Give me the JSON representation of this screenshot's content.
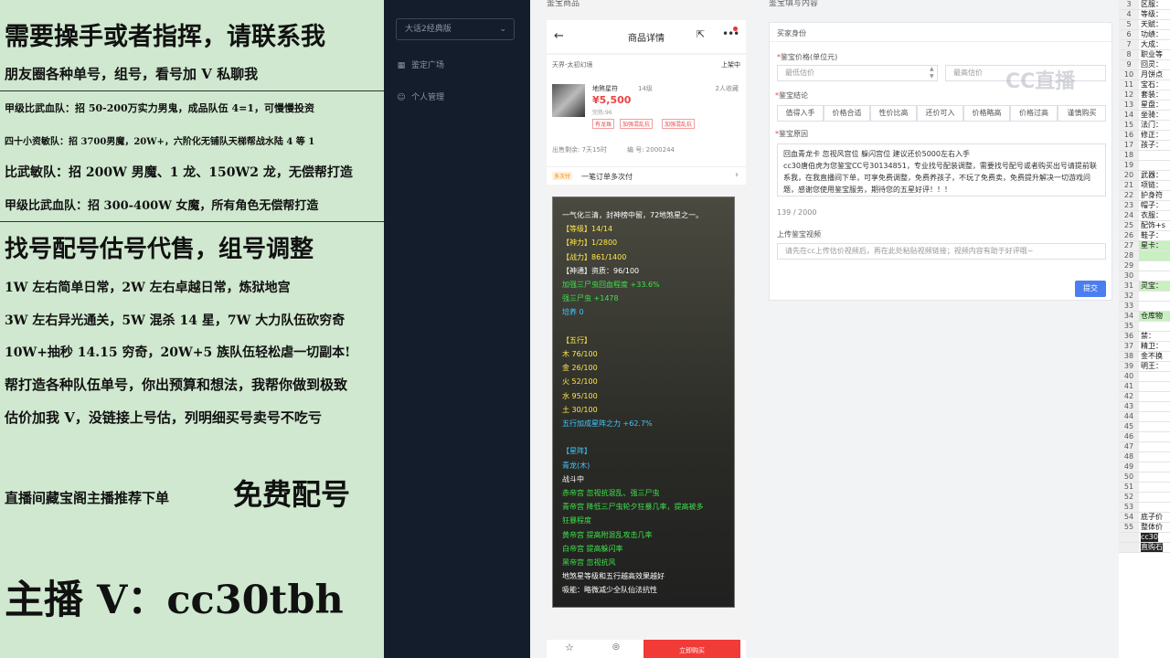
{
  "promo": {
    "lines": [
      "需要操手或者指挥，请联系我",
      "朋友圈各种单号，组号，看号加 V 私聊我",
      "甲级比武血队：招 50-200万实力男鬼，成品队伍 4=1，可慢慢投资",
      "四十小资敏队：招 3700男魔，20W+，六阶化无铺队天梯帮战水陆 4 等 1",
      "比武敏队：招 200W 男魔、1 龙、150W2 龙，无偿帮打造",
      "甲级比武血队：招 300-400W 女魔，所有角色无偿帮打造",
      "找号配号估号代售，组号调整",
      "1W 左右简单日常，2W 左右卓越日常，炼狱地宫",
      "3W 左右异光通关，5W 混杀 14 星，7W 大力队伍砍穷奇",
      "10W+抽秒 14.15 穷奇，20W+5 族队伍轻松虐一切副本!",
      "帮打造各种队伍单号，你出预算和想法，我帮你做到极致",
      "估价加我 V，没链接上号估，列明细买号卖号不吃亏",
      "直播间藏宝阁主播推荐下单",
      "免费配号",
      "主播 V：cc30tbh"
    ]
  },
  "sidebar": {
    "system_select": "大话2经典版",
    "items": [
      "鉴定广场",
      "个人管理"
    ]
  },
  "phone": {
    "column_title": "鉴宝商品",
    "title": "商品详情",
    "server": "天界-太初幻境",
    "status": "上架中",
    "role_name": "地煞星符",
    "level": "14级",
    "favorites": "2人收藏",
    "price": "¥5,500",
    "hint": "完热:96",
    "tags": [
      "有龙珠",
      "加强混乱抗",
      "加强混乱抗"
    ],
    "remaining": "出售剩余: 7天15时",
    "item_id": "编 号: 2000244",
    "promo_tag": "多次付",
    "promo_text": "一笔订单多次付",
    "buy_label": "立即购买",
    "consult_label": "咨询",
    "detail_lines": [
      {
        "t": "一气化三清，封神榜中留，72地煞星之一。",
        "c": "#ffffff"
      },
      {
        "t": "【等级】14/14",
        "c": "#ffe84a"
      },
      {
        "t": "【神力】1/2800",
        "c": "#ffe84a"
      },
      {
        "t": "【战力】861/1400",
        "c": "#ffe84a"
      },
      {
        "t": "【神通】资质：96/100",
        "c": "#ffffff"
      },
      {
        "t": "加强三尸虫回血程度 +33.6%",
        "c": "#3de24a"
      },
      {
        "t": "强三尸虫 +1478",
        "c": "#3de24a"
      },
      {
        "t": "培养 0",
        "c": "#41c7ff"
      },
      {
        "t": "",
        "c": "#ffffff"
      },
      {
        "t": "【五行】",
        "c": "#ffe84a"
      },
      {
        "t": "木 76/100",
        "c": "#ffe84a"
      },
      {
        "t": "金 26/100",
        "c": "#ffe84a"
      },
      {
        "t": "火 52/100",
        "c": "#ffe84a"
      },
      {
        "t": "水 95/100",
        "c": "#ffe84a"
      },
      {
        "t": "土 30/100",
        "c": "#ffe84a"
      },
      {
        "t": "五行加成星阵之力 +62.7%",
        "c": "#41c7ff"
      },
      {
        "t": "",
        "c": "#ffffff"
      },
      {
        "t": "【星阵】",
        "c": "#41c7ff"
      },
      {
        "t": "青龙(木)",
        "c": "#41c7ff"
      },
      {
        "t": "战斗中",
        "c": "#ffffff"
      },
      {
        "t": "赤帝宫 忽视抗混乱、强三尸虫",
        "c": "#3de24a"
      },
      {
        "t": "青帝宫 降低三尸虫轮夕狂暴几率，提高被多",
        "c": "#3de24a"
      },
      {
        "t": "狂暴程度",
        "c": "#3de24a"
      },
      {
        "t": "黄帝宫 提高附混乱攻击几率",
        "c": "#3de24a"
      },
      {
        "t": "白帝宫 提高躲闪率",
        "c": "#3de24a"
      },
      {
        "t": "黑帝宫 忽视抗风",
        "c": "#3de24a"
      },
      {
        "t": "地煞星等级和五行越高效果越好",
        "c": "#ffffff"
      },
      {
        "t": "吸能：略微减少全队仙法抗性",
        "c": "#ffffff"
      }
    ]
  },
  "form": {
    "column_title": "鉴宝填写内容",
    "section": "买家身份",
    "price_label": "鉴宝价格(单位元)",
    "min_placeholder": "最低估价",
    "max_placeholder": "最高估价",
    "conclusion_label": "鉴宝结论",
    "options": [
      "值得入手",
      "价格合适",
      "性价比高",
      "还价可入",
      "价格略高",
      "价格过高",
      "谨慎购买"
    ],
    "reason_label": "鉴宝原因",
    "reason_text": "回血青龙卡 忽视风宫位 躲闪宫位 建议还价5000左右入手\ncc30唐伯虎为您鉴宝CC号30134851，专业找号配装调整，需要找号配号或者购买出号请提前联系我，在我直播间下单，可享免费调整，免费养孩子，不玩了免费卖，免费提升解决一切游戏问题，感谢您使用鉴宝服务，期待您的五星好评！！！",
    "char_count": "139 / 2000",
    "video_label": "上传鉴宝视频",
    "video_placeholder": "请先在cc上传估价视频后，再在此处粘贴视频链接；视频内容有助于好评哦~",
    "submit_label": "提交",
    "watermark": "CC直播"
  },
  "sheet": {
    "rows": [
      {
        "n": "3",
        "t": "区服：",
        "hl": false
      },
      {
        "n": "4",
        "t": "等级：",
        "hl": false
      },
      {
        "n": "5",
        "t": "天赋：",
        "hl": false
      },
      {
        "n": "6",
        "t": "功绩：",
        "hl": false
      },
      {
        "n": "7",
        "t": "大成：",
        "hl": false
      },
      {
        "n": "8",
        "t": "职业等",
        "hl": false
      },
      {
        "n": "9",
        "t": "回灵：",
        "hl": false
      },
      {
        "n": "10",
        "t": "月饼点",
        "hl": false
      },
      {
        "n": "11",
        "t": "宝石：",
        "hl": false
      },
      {
        "n": "12",
        "t": "套装：",
        "hl": false
      },
      {
        "n": "13",
        "t": "星盘：",
        "hl": false
      },
      {
        "n": "14",
        "t": "坐骑：",
        "hl": false
      },
      {
        "n": "15",
        "t": "法门：",
        "hl": false
      },
      {
        "n": "16",
        "t": "修正：",
        "hl": false
      },
      {
        "n": "17",
        "t": "孩子：",
        "hl": false
      },
      {
        "n": "18",
        "t": "",
        "hl": false
      },
      {
        "n": "19",
        "t": "",
        "hl": false
      },
      {
        "n": "20",
        "t": "武器：",
        "hl": false
      },
      {
        "n": "21",
        "t": "项链：",
        "hl": false
      },
      {
        "n": "22",
        "t": "护身符",
        "hl": false
      },
      {
        "n": "23",
        "t": "帽子：",
        "hl": false
      },
      {
        "n": "24",
        "t": "衣服：",
        "hl": false
      },
      {
        "n": "25",
        "t": "配饰+s",
        "hl": false
      },
      {
        "n": "26",
        "t": "鞋子：",
        "hl": false
      },
      {
        "n": "27",
        "t": "星卡：",
        "hl": true
      },
      {
        "n": "28",
        "t": "",
        "hl": true
      },
      {
        "n": "29",
        "t": "",
        "hl": false
      },
      {
        "n": "30",
        "t": "",
        "hl": false
      },
      {
        "n": "31",
        "t": "灵宝：",
        "hl": true
      },
      {
        "n": "32",
        "t": "",
        "hl": false
      },
      {
        "n": "33",
        "t": "",
        "hl": false
      },
      {
        "n": "34",
        "t": "仓库物",
        "hl": true
      },
      {
        "n": "35",
        "t": "",
        "hl": false
      },
      {
        "n": "36",
        "t": "禁：",
        "hl": false
      },
      {
        "n": "37",
        "t": "精卫：",
        "hl": false
      },
      {
        "n": "38",
        "t": "金不换",
        "hl": false
      },
      {
        "n": "39",
        "t": "明王：",
        "hl": false
      },
      {
        "n": "40",
        "t": "",
        "hl": false
      },
      {
        "n": "41",
        "t": "",
        "hl": false
      },
      {
        "n": "42",
        "t": "",
        "hl": false
      },
      {
        "n": "43",
        "t": "",
        "hl": false
      },
      {
        "n": "44",
        "t": "",
        "hl": false
      },
      {
        "n": "45",
        "t": "",
        "hl": false
      },
      {
        "n": "46",
        "t": "",
        "hl": false
      },
      {
        "n": "47",
        "t": "",
        "hl": false
      },
      {
        "n": "48",
        "t": "",
        "hl": false
      },
      {
        "n": "49",
        "t": "",
        "hl": false
      },
      {
        "n": "50",
        "t": "",
        "hl": false
      },
      {
        "n": "51",
        "t": "",
        "hl": false
      },
      {
        "n": "52",
        "t": "",
        "hl": false
      },
      {
        "n": "53",
        "t": "",
        "hl": false
      },
      {
        "n": "54",
        "t": "底子价",
        "hl": false
      },
      {
        "n": "55",
        "t": "整体价",
        "hl": false
      },
      {
        "n": "",
        "t": "cc30",
        "hl": false
      },
      {
        "n": "",
        "t": "直购石",
        "hl": false
      }
    ]
  }
}
